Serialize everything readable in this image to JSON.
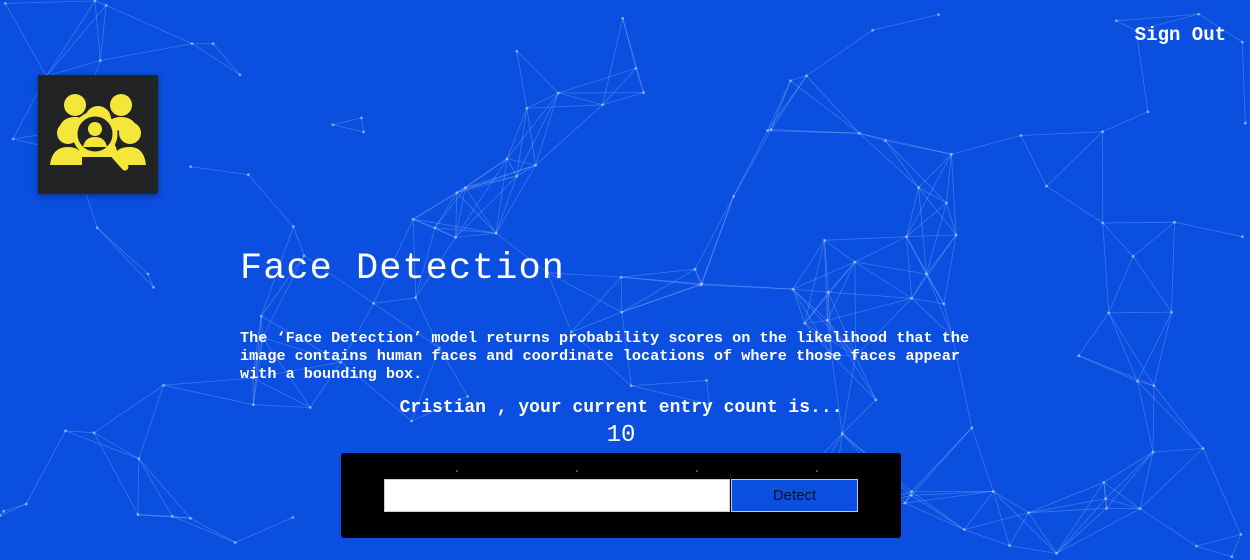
{
  "nav": {
    "sign_out": "Sign Out"
  },
  "logo": {
    "icon": "face-search-icon",
    "color": "#f5e63a"
  },
  "main": {
    "title": "Face Detection",
    "description": "The ‘Face Detection’ model returns probability scores on the likelihood that the image contains human faces and coordinate locations of where those faces appear with a bounding box.",
    "entry_message": "Cristian , your current entry count is...",
    "entry_count": "10"
  },
  "form": {
    "input_value": "",
    "input_placeholder": "",
    "button_label": "Detect"
  },
  "colors": {
    "background": "#0a4fe0",
    "form_panel": "#000000",
    "logo_panel": "#222325"
  }
}
